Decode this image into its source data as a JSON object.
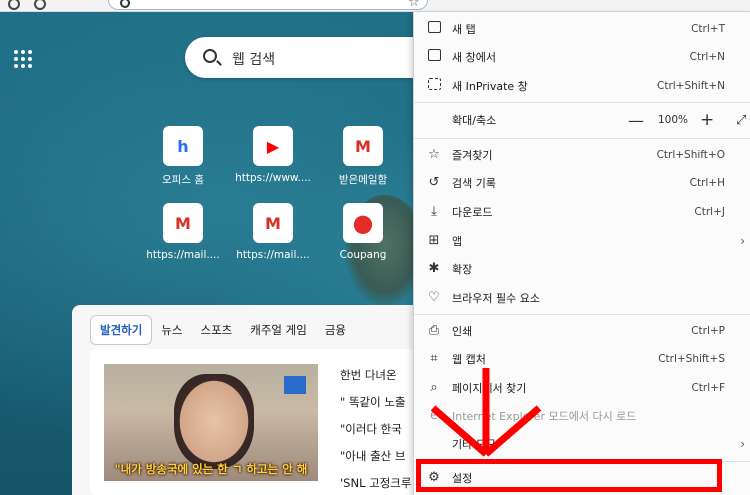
{
  "colors": {
    "highlight": "#ff0000",
    "accent": "#235fc0"
  },
  "ntp": {
    "search_placeholder": "웹 검색",
    "tiles": [
      {
        "label": "오피스 홈",
        "icon": "office-home-icon",
        "glyph": "h"
      },
      {
        "label": "https://www....",
        "icon": "youtube-icon",
        "glyph": "▶"
      },
      {
        "label": "받은메일함",
        "icon": "mail-icon",
        "glyph": "M"
      },
      {
        "label": "https://mail....",
        "icon": "gmail-icon",
        "glyph": "M"
      },
      {
        "label": "https://mail....",
        "icon": "gmail-icon",
        "glyph": "M"
      },
      {
        "label": "Coupang",
        "icon": "coupang-icon",
        "glyph": "●"
      }
    ]
  },
  "news": {
    "tabs": [
      "발견하기",
      "뉴스",
      "스포츠",
      "캐주얼 게임",
      "금융"
    ],
    "caption": "\"내가 방송국에 있는 한 ㄱ  하고는 안 해",
    "headlines": [
      "한번 다녀온",
      "\" 똑같이 노출",
      "\"이러다 한국",
      "\"아내 출산 브",
      "'SNL 고정크루"
    ]
  },
  "menu": {
    "items": [
      {
        "label": "새 탭",
        "shortcut": "Ctrl+T",
        "icon": "new-tab-icon"
      },
      {
        "label": "새 창에서",
        "shortcut": "Ctrl+N",
        "icon": "new-window-icon"
      },
      {
        "label": "새 InPrivate 창",
        "shortcut": "Ctrl+Shift+N",
        "icon": "inprivate-icon"
      },
      {
        "label": "확대/축소",
        "shortcut": "",
        "icon": ""
      },
      {
        "label": "즐겨찾기",
        "shortcut": "Ctrl+Shift+O",
        "icon": "favorites-icon"
      },
      {
        "label": "검색 기록",
        "shortcut": "Ctrl+H",
        "icon": "history-icon"
      },
      {
        "label": "다운로드",
        "shortcut": "Ctrl+J",
        "icon": "download-icon"
      },
      {
        "label": "앱",
        "shortcut": "",
        "icon": "apps-icon"
      },
      {
        "label": "확장",
        "shortcut": "",
        "icon": "extensions-icon"
      },
      {
        "label": "브라우저 필수 요소",
        "shortcut": "",
        "icon": "browser-essentials-icon"
      },
      {
        "label": "인쇄",
        "shortcut": "Ctrl+P",
        "icon": "print-icon"
      },
      {
        "label": "웹 캡처",
        "shortcut": "Ctrl+Shift+S",
        "icon": "web-capture-icon"
      },
      {
        "label": "페이지에서 찾기",
        "shortcut": "Ctrl+F",
        "icon": "find-icon"
      },
      {
        "label": "Internet Explorer 모드에서 다시 로드",
        "shortcut": "",
        "icon": "ie-icon"
      },
      {
        "label": "기타 도구",
        "shortcut": "",
        "icon": "tools-icon"
      },
      {
        "label": "설정",
        "shortcut": "",
        "icon": "settings-icon"
      }
    ],
    "zoom_value": "100%"
  }
}
